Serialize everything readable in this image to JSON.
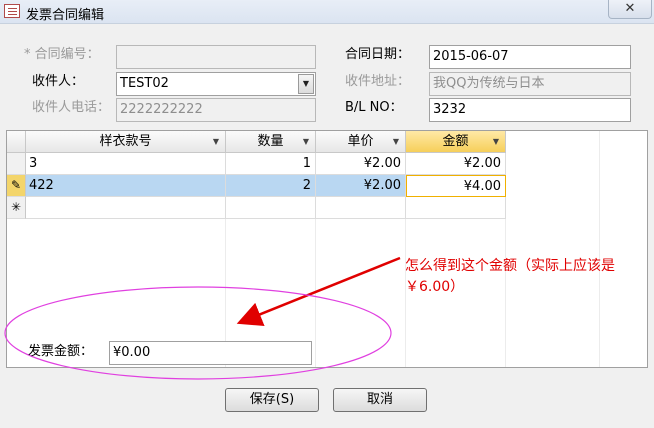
{
  "window": {
    "title": "发票合同编辑",
    "close_glyph": "✕"
  },
  "form": {
    "contract_no_label": "* 合同编号：",
    "contract_no_value": "",
    "contract_date_label": "合同日期：",
    "contract_date_value": "2015-06-07",
    "recipient_label": "收件人：",
    "recipient_value": "TEST02",
    "recipient_address_label": "收件地址：",
    "recipient_address_value": "我QQ为传统与日本",
    "recipient_phone_label": "收件人电话：",
    "recipient_phone_value": "2222222222",
    "bl_no_label": "B/L NO：",
    "bl_no_value": "3232",
    "dropdown_glyph": "▼"
  },
  "grid": {
    "columns": [
      "样衣款号",
      "数量",
      "单价",
      "金额"
    ],
    "sort_glyph": "▼",
    "rows": [
      {
        "marker": "",
        "style_no": "3",
        "qty": "1",
        "price": "¥2.00",
        "amount": "¥2.00"
      },
      {
        "marker": "✎",
        "style_no": "422",
        "qty": "2",
        "price": "¥2.00",
        "amount": "¥4.00"
      }
    ],
    "new_row_marker": "✳"
  },
  "footer": {
    "invoice_amount_label": "发票金额：",
    "invoice_amount_value": "¥0.00",
    "save_label": "保存(S)",
    "cancel_label": "取消"
  },
  "annotation": {
    "text": "怎么得到这个金额（实际上应该是￥6.00）"
  },
  "colors": {
    "annotation_red": "#e00000",
    "ellipse_magenta": "#e040e0",
    "selected_row": "#b9d7f2",
    "selected_header": "#f6cf5a"
  }
}
